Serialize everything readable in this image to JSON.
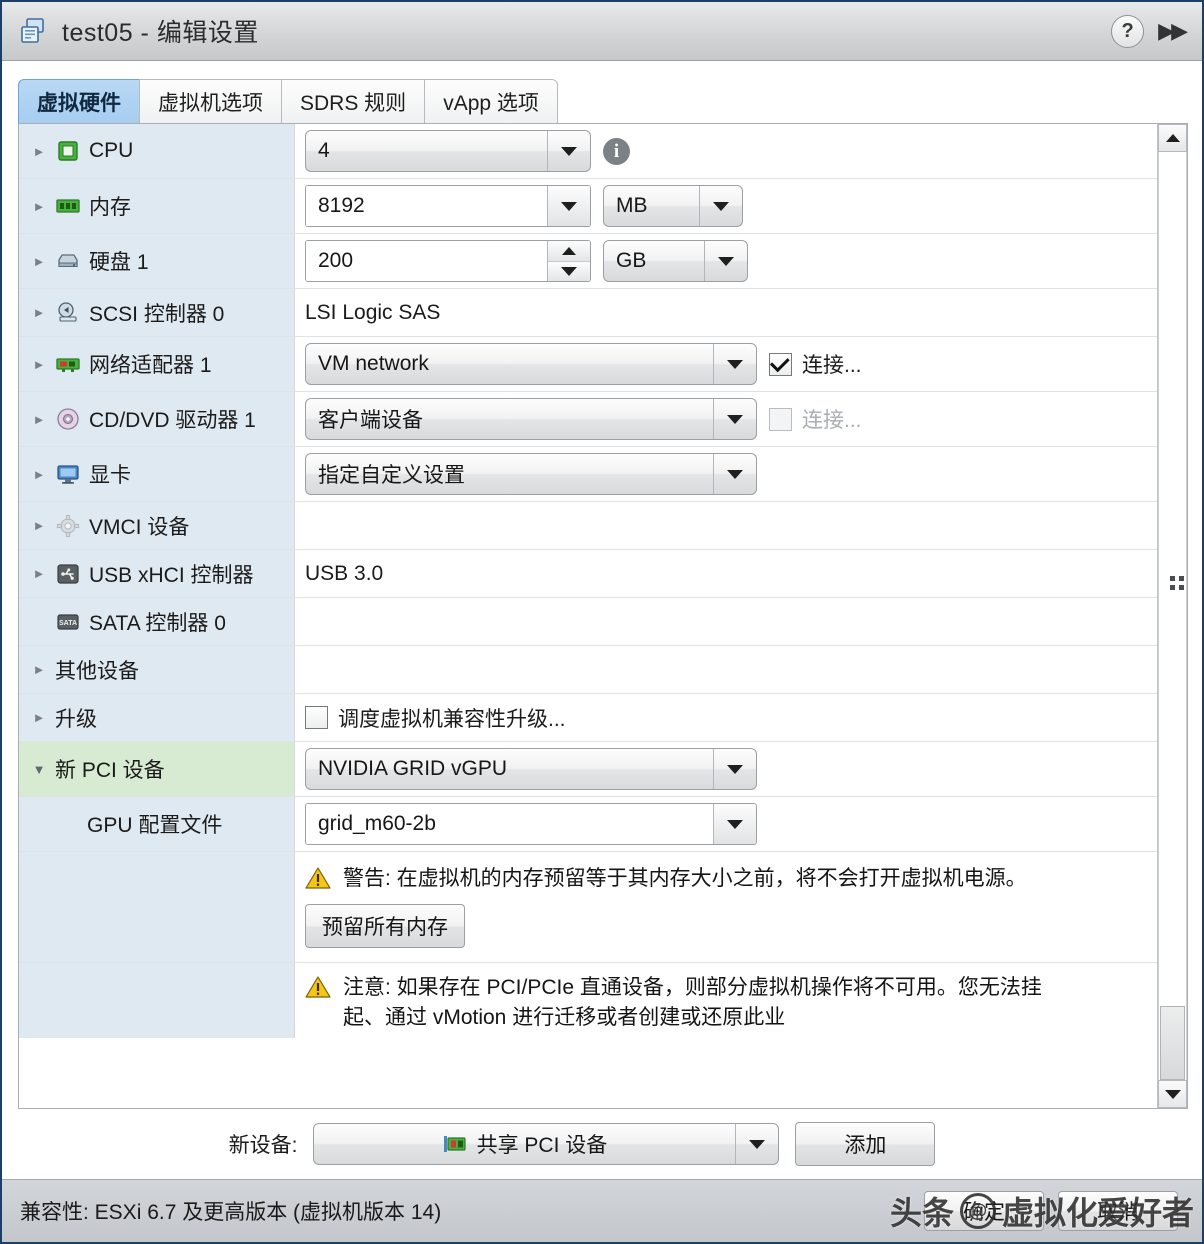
{
  "window": {
    "title": "test05 - 编辑设置",
    "title_icon": "virtual-machine-icon",
    "help_icon": "?",
    "collapse_icon": "▶▶"
  },
  "tabs": [
    {
      "label": "虚拟硬件",
      "active": true
    },
    {
      "label": "虚拟机选项",
      "active": false
    },
    {
      "label": "SDRS 规则",
      "active": false
    },
    {
      "label": "vApp 选项",
      "active": false
    }
  ],
  "devices": [
    {
      "name": "CPU",
      "icon": "cpu-icon",
      "value": "4",
      "control": "combo",
      "info": "i"
    },
    {
      "name": "内存",
      "icon": "memory-icon",
      "value": "8192",
      "control": "field-combo",
      "unit": "MB"
    },
    {
      "name": "硬盘 1",
      "icon": "harddisk-icon",
      "value": "200",
      "control": "field-spinner",
      "unit": "GB"
    },
    {
      "name": "SCSI 控制器 0",
      "icon": "scsi-controller-icon",
      "value": "LSI Logic SAS",
      "control": "text"
    },
    {
      "name": "网络适配器 1",
      "icon": "network-adapter-icon",
      "value": "VM network",
      "control": "combo",
      "checkbox": "连接...",
      "checked": true
    },
    {
      "name": "CD/DVD 驱动器 1",
      "icon": "cddvd-drive-icon",
      "value": "客户端设备",
      "control": "combo",
      "checkbox": "连接...",
      "checked": false,
      "checkbox_disabled": true
    },
    {
      "name": "显卡",
      "icon": "video-card-icon",
      "value": "指定自定义设置",
      "control": "combo"
    },
    {
      "name": "VMCI 设备",
      "icon": "vmci-device-icon",
      "value": "",
      "control": "none"
    },
    {
      "name": "USB xHCI 控制器",
      "icon": "usb-controller-icon",
      "value": "USB 3.0",
      "control": "text"
    },
    {
      "name": "SATA 控制器 0",
      "icon": "sata-controller-icon",
      "value": "",
      "control": "none",
      "no_twisty": true
    },
    {
      "name": "其他设备",
      "icon": "",
      "value": "",
      "control": "none"
    },
    {
      "name": "升级",
      "icon": "",
      "value": "",
      "control": "checkbox",
      "checkbox": "调度虚拟机兼容性升级...",
      "checked": false
    }
  ],
  "pci": {
    "row_label": "新 PCI 设备",
    "device_value": "NVIDIA GRID vGPU",
    "profile_label": "GPU 配置文件",
    "profile_value": "grid_m60-2b",
    "warning_icon": "warning-triangle-icon",
    "warning_text": "警告: 在虚拟机的内存预留等于其内存大小之前，将不会打开虚拟机电源。",
    "reserve_button": "预留所有内存",
    "note_icon": "warning-triangle-icon",
    "note_text": "注意: 如果存在 PCI/PCIe 直通设备，则部分虚拟机操作将不可用。您无法挂起、通过 vMotion 进行迁移或者创建或还原此业"
  },
  "new_device_bar": {
    "label": "新设备:",
    "selected": "共享 PCI 设备",
    "device_icon": "shared-pci-device-icon",
    "add_button": "添加"
  },
  "statusbar": {
    "compatibility": "兼容性: ESXi 6.7 及更高版本 (虚拟机版本 14)",
    "ok_button": "确定",
    "cancel_button": "取消",
    "watermark_left": "头条",
    "watermark_at": "@",
    "watermark_right": "虚拟化爱好者"
  },
  "colors": {
    "label_column": "#dfe9f1",
    "new_device_row": "#d6ebd2",
    "tab_active": "#a7cdf0",
    "window_border": "#1c3f66",
    "warning_yellow": "#f5c518"
  }
}
